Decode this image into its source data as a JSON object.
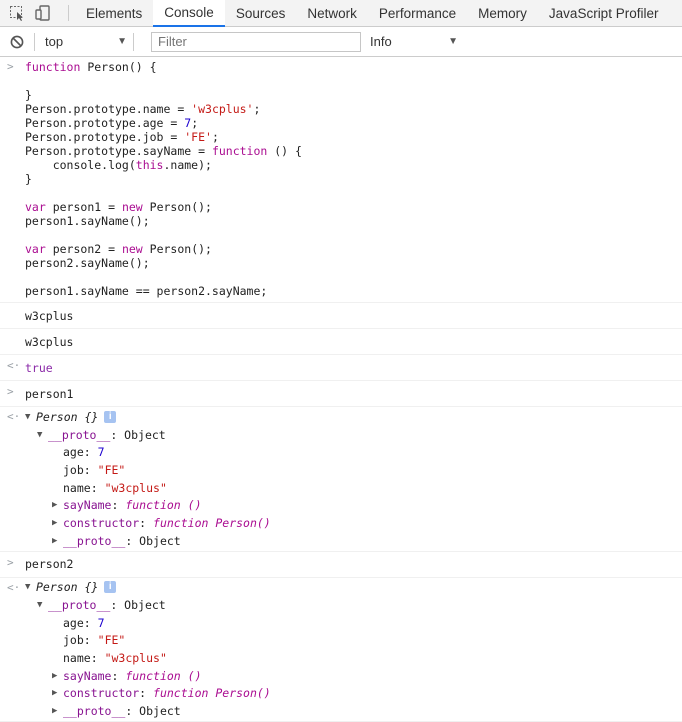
{
  "tabs": [
    "Elements",
    "Console",
    "Sources",
    "Network",
    "Performance",
    "Memory",
    "JavaScript Profiler"
  ],
  "toolbar": {
    "context": "top",
    "filter_placeholder": "Filter",
    "level": "Info"
  },
  "input1": {
    "line1": "function Person() {",
    "line2": "",
    "line3": "}",
    "line4a": "Person.prototype.name = ",
    "line4s": "'w3cplus'",
    "line4e": ";",
    "line5a": "Person.prototype.age = ",
    "line5n": "7",
    "line5e": ";",
    "line6a": "Person.prototype.job = ",
    "line6s": "'FE'",
    "line6e": ";",
    "line7a": "Person.prototype.sayName = ",
    "line7k": "function",
    "line7e": " () {",
    "line8a": "    console.log(",
    "line8k": "this",
    "line8e": ".name);",
    "line9": "}",
    "line11k": "var",
    "line11a": " person1 = ",
    "line11n": "new",
    "line11e": " Person();",
    "line12": "person1.sayName();",
    "line14k": "var",
    "line14a": " person2 = ",
    "line14n": "new",
    "line14e": " Person();",
    "line15": "person2.sayName();",
    "line17": "person1.sayName == person2.sayName;"
  },
  "log1": "w3cplus",
  "log2": "w3cplus",
  "result1": "true",
  "input2": "person1",
  "input3": "person2",
  "obj": {
    "title": "Person {}",
    "proto_key": "__proto__",
    "proto_val": "Object",
    "age_key": "age",
    "age_val": "7",
    "job_key": "job",
    "job_val": "\"FE\"",
    "name_key": "name",
    "name_val": "\"w3cplus\"",
    "sayName_key": "sayName",
    "sayName_val": "function ()",
    "ctor_key": "constructor",
    "ctor_val": "function Person()",
    "proto2_key": "__proto__",
    "proto2_val": "Object",
    "info": "i"
  }
}
